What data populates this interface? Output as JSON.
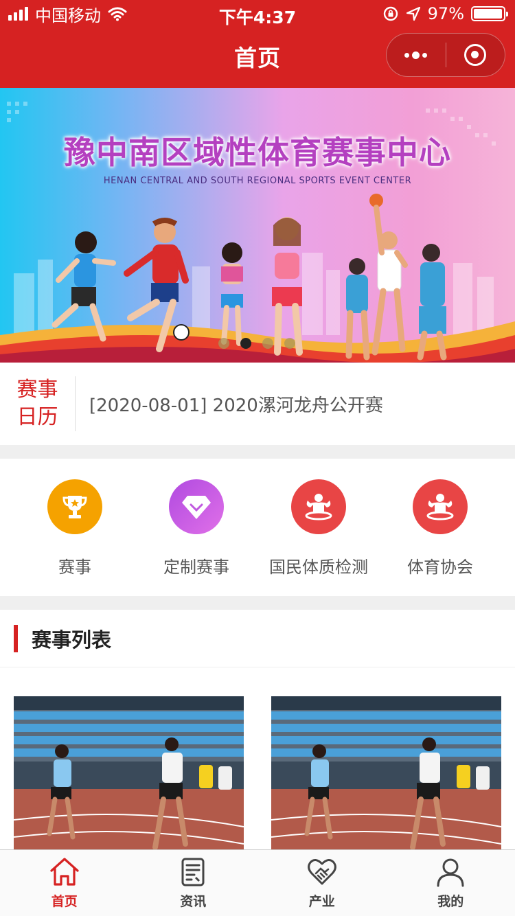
{
  "status_bar": {
    "carrier": "中国移动",
    "time": "下午4:37",
    "battery": "97%",
    "battery_level": 0.97
  },
  "nav": {
    "title": "首页"
  },
  "banner": {
    "title": "豫中南区域性体育赛事中心",
    "subtitle": "HENAN CENTRAL AND SOUTH REGIONAL SPORTS EVENT CENTER",
    "slide_count": 4,
    "active_slide": 1
  },
  "calendar": {
    "label_line1": "赛事",
    "label_line2": "日历",
    "notice": "[2020-08-01] 2020漯河龙舟公开赛"
  },
  "entries": [
    {
      "label": "赛事",
      "icon": "trophy-icon",
      "color": "#f5a200"
    },
    {
      "label": "定制赛事",
      "icon": "diamond-icon",
      "color": "#c05ae0"
    },
    {
      "label": "国民体质检测",
      "icon": "muscle-icon",
      "color": "#e84545"
    },
    {
      "label": "体育协会",
      "icon": "muscle-icon",
      "color": "#e84545"
    }
  ],
  "event_list": {
    "title": "赛事列表"
  },
  "tabbar": [
    {
      "label": "首页",
      "icon": "home-icon",
      "active": true
    },
    {
      "label": "资讯",
      "icon": "news-icon",
      "active": false
    },
    {
      "label": "产业",
      "icon": "handshake-icon",
      "active": false
    },
    {
      "label": "我的",
      "icon": "user-icon",
      "active": false
    }
  ],
  "colors": {
    "brand": "#d62222",
    "text": "#555555"
  }
}
